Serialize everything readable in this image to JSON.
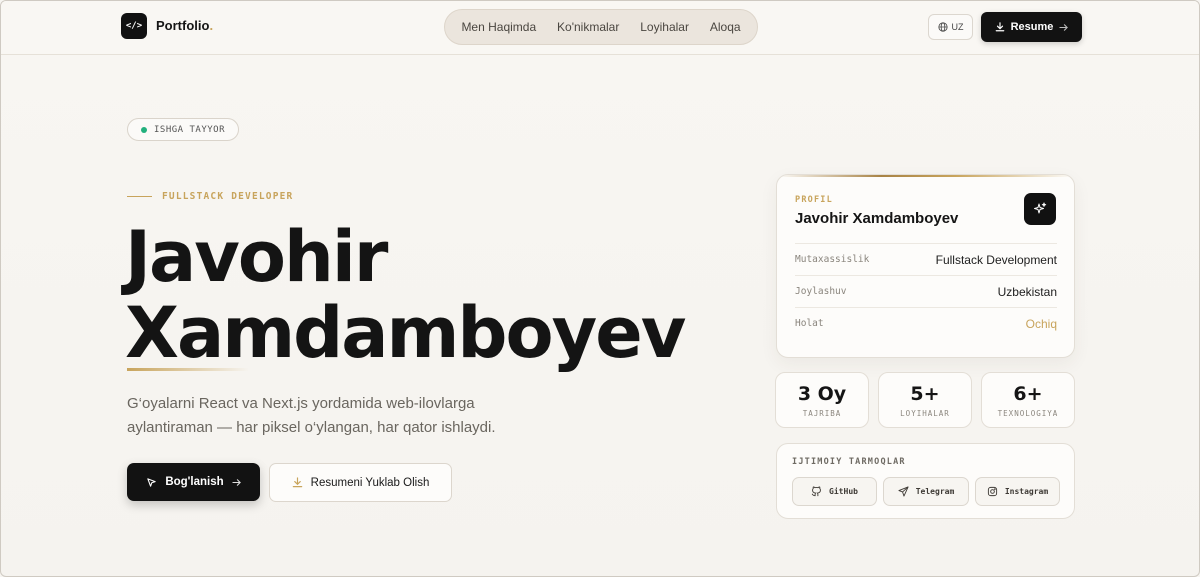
{
  "nav": {
    "logo_glyph": "</>",
    "brand": "Portfolio",
    "brand_dot": ".",
    "links": [
      "Men Haqimda",
      "Ko'nikmalar",
      "Loyihalar",
      "Aloqa"
    ],
    "lang": "UZ",
    "resume_label": "Resume"
  },
  "hero": {
    "status": "ISHGA TAYYOR",
    "role": "FULLSTACK DEVELOPER",
    "name_line1": "Javohir",
    "name_line2": "Xamdamboyev",
    "description": "G‘oyalarni React va Next.js yordamida web-ilovlarga aylantiraman — har piksel o‘ylangan, har qator ishlaydi.",
    "contact_button": "Bog'lanish",
    "download_button": "Resumeni Yuklab Olish"
  },
  "profile": {
    "label": "PROFIL",
    "name": "Javohir Xamdamboyev",
    "rows": [
      {
        "key": "Mutaxassislik",
        "value": "Fullstack Development"
      },
      {
        "key": "Joylashuv",
        "value": "Uzbekistan"
      },
      {
        "key": "Holat",
        "value": "Ochiq"
      }
    ]
  },
  "stats": [
    {
      "value": "3 Oy",
      "label": "TAJRIBA"
    },
    {
      "value": "5+",
      "label": "LOYIHALAR"
    },
    {
      "value": "6+",
      "label": "TEXNOLOGIYA"
    }
  ],
  "social": {
    "title": "IJTIMOIY TARMOQLAR",
    "links": [
      "GitHub",
      "Telegram",
      "Instagram"
    ]
  },
  "colors": {
    "accent_gold": "#c8a45c",
    "status_green": "#22b07d",
    "dark": "#121212"
  },
  "icons": {
    "brand": "code-icon",
    "lang": "globe-icon",
    "resume": "download-icon",
    "profile": "sparkles-icon",
    "contact": "cursor-icon",
    "social": [
      "github-icon",
      "send-icon",
      "instagram-icon"
    ]
  }
}
